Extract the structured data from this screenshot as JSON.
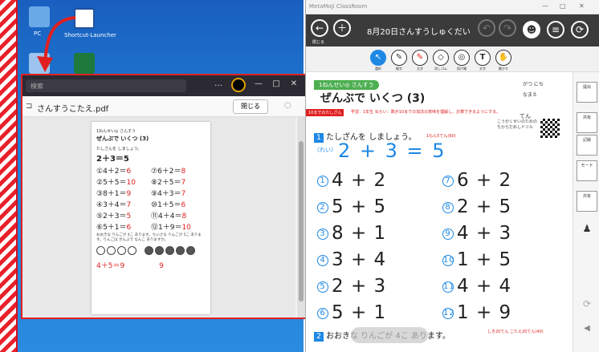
{
  "desktop": {
    "icons": [
      {
        "label": "PC"
      },
      {
        "label": "Shortcut-Launcher"
      },
      {
        "label": ""
      },
      {
        "label": ""
      }
    ]
  },
  "viewer": {
    "search_text": "検索",
    "window_controls": [
      "…",
      "—",
      "□",
      "✕"
    ],
    "filename": "さんすうこたえ.pdf",
    "close_label": "閉じる",
    "page": {
      "grade": "1ねんせい◎ さんすう",
      "title": "ぜんぶで いくつ (3)",
      "section1": "たしざんを しましょう。",
      "example": "2＋3＝5",
      "rows": [
        {
          "l_q": "①4＋2＝",
          "l_a": "6",
          "r_q": "⑦6＋2＝",
          "r_a": "8"
        },
        {
          "l_q": "②5＋5＝",
          "l_a": "10",
          "r_q": "⑧2＋5＝",
          "r_a": "7"
        },
        {
          "l_q": "③8＋1＝",
          "l_a": "9",
          "r_q": "⑨4＋3＝",
          "r_a": "7"
        },
        {
          "l_q": "④3＋4＝",
          "l_a": "7",
          "r_q": "⑩1＋5＝",
          "r_a": "6"
        },
        {
          "l_q": "⑤2＋3＝",
          "l_a": "5",
          "r_q": "⑪4＋4＝",
          "r_a": "8"
        },
        {
          "l_q": "⑥5＋1＝",
          "l_a": "6",
          "r_q": "⑫1＋9＝",
          "r_a": "10"
        }
      ],
      "section2_text": "おおきな りんごが 4こ あります。ちいさな りんごが 5こ あります。りんごは ぜんぶで なんこ ありますか。",
      "bottom_formula": "4＋5＝9",
      "bottom_answer": "9"
    }
  },
  "metamoji": {
    "title": "MetaMoJi ClassRoom",
    "window_controls": [
      "—",
      "□",
      "✕"
    ],
    "back_label": "閉じる",
    "doc_title": "8月20日さんすうしゅくだい",
    "tools": [
      {
        "icon": "select-icon",
        "glyph": "↖",
        "label": "選択"
      },
      {
        "icon": "pen-icon",
        "glyph": "✎",
        "label": "細字"
      },
      {
        "icon": "marker-icon",
        "glyph": "✎",
        "label": "太字"
      },
      {
        "icon": "eraser-icon",
        "glyph": "◇",
        "label": "消しゴム"
      },
      {
        "icon": "lasso-icon",
        "glyph": "◎",
        "label": "投げ縄"
      },
      {
        "icon": "text-icon",
        "glyph": "T",
        "label": "文字"
      },
      {
        "icon": "hand-icon",
        "glyph": "✋",
        "label": "動かす"
      }
    ],
    "sidebar": [
      {
        "label": "提出"
      },
      {
        "label": "共有"
      },
      {
        "label": "記録"
      },
      {
        "label": "モード"
      },
      {
        "label": "共有"
      }
    ],
    "worksheet": {
      "grade": "1ねんせい◎ さんすう",
      "title": "ぜんぶで いくつ (3)",
      "name_label": "なまえ",
      "class_label": "がつ にち",
      "note_tag": "10までのたしざん",
      "meta": "学習：1年生 ねらい：数が10までの加法の意味を理解し、計算できるようにする。",
      "score_label": "てん",
      "logo": "こうがくせいのための ちからだめしドリル",
      "section1": "たしざんを しましょう。",
      "section1_pts": "1もん5てん(60)",
      "example_label": "〈れい〉",
      "example": "2 + 3 = 5",
      "problems": [
        {
          "num": "1",
          "expr": "4 + 2"
        },
        {
          "num": "2",
          "expr": "5 + 5"
        },
        {
          "num": "3",
          "expr": "8 + 1"
        },
        {
          "num": "4",
          "expr": "3 + 4"
        },
        {
          "num": "5",
          "expr": "2 + 3"
        },
        {
          "num": "6",
          "expr": "5 + 1"
        },
        {
          "num": "7",
          "expr": "6 + 2"
        },
        {
          "num": "8",
          "expr": "2 + 5"
        },
        {
          "num": "9",
          "expr": "4 + 3"
        },
        {
          "num": "10",
          "expr": "1 + 5"
        },
        {
          "num": "11",
          "expr": "4 + 4"
        },
        {
          "num": "12",
          "expr": "1 + 9"
        }
      ],
      "section2": "おおきな りんごが 4こ あります。",
      "section2_pts": "しき20てん こたえ20てん(40)"
    }
  },
  "colors": {
    "accent": "#1e88e5",
    "answer": "#e02020",
    "header": "#3b3b3b"
  }
}
